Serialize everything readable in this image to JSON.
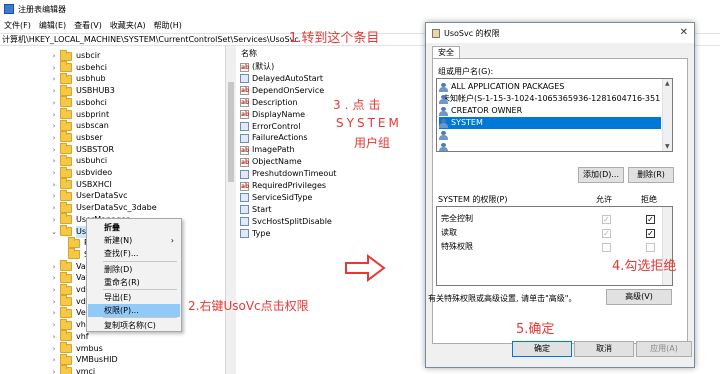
{
  "window": {
    "title": "注册表编辑器",
    "menu": [
      "文件(F)",
      "编辑(E)",
      "查看(V)",
      "收藏夹(A)",
      "帮助(H)"
    ],
    "address": "计算机\\HKEY_LOCAL_MACHINE\\SYSTEM\\CurrentControlSet\\Services\\UsoSvc"
  },
  "tree": {
    "items": [
      {
        "label": "usbcir",
        "chevron": "›"
      },
      {
        "label": "usbehci",
        "chevron": "›"
      },
      {
        "label": "usbhub",
        "chevron": "›"
      },
      {
        "label": "USBHUB3",
        "chevron": "›"
      },
      {
        "label": "usbohci",
        "chevron": "›"
      },
      {
        "label": "usbprint",
        "chevron": "›"
      },
      {
        "label": "usbscan",
        "chevron": "›"
      },
      {
        "label": "usbser",
        "chevron": "›"
      },
      {
        "label": "USBSTOR",
        "chevron": "›"
      },
      {
        "label": "usbuhci",
        "chevron": "›"
      },
      {
        "label": "usbvideo",
        "chevron": "›"
      },
      {
        "label": "USBXHCI",
        "chevron": "›"
      },
      {
        "label": "UserDataSvc",
        "chevron": "›"
      },
      {
        "label": "UserDataSvc_3dabe",
        "chevron": "›"
      },
      {
        "label": "UserManager",
        "chevron": "›"
      },
      {
        "label": "UsoSvc",
        "chevron": "⌄"
      },
      {
        "label": "P",
        "chevron": ""
      },
      {
        "label": "S",
        "chevron": ""
      },
      {
        "label": "Vac",
        "chevron": "›"
      },
      {
        "label": "Vau",
        "chevron": "›"
      },
      {
        "label": "vdrv",
        "chevron": "›"
      },
      {
        "label": "vds",
        "chevron": "›"
      },
      {
        "label": "Veri",
        "chevron": "›"
      },
      {
        "label": "vhd",
        "chevron": "›"
      },
      {
        "label": "vhf",
        "chevron": "›"
      },
      {
        "label": "vmbus",
        "chevron": "›"
      },
      {
        "label": "VMBusHID",
        "chevron": "›"
      },
      {
        "label": "vmci",
        "chevron": "›"
      }
    ]
  },
  "values": {
    "header": "名称",
    "items": [
      {
        "name": "(默认)",
        "type": "ab"
      },
      {
        "name": "DelayedAutoStart",
        "type": "bin"
      },
      {
        "name": "DependOnService",
        "type": "ab"
      },
      {
        "name": "Description",
        "type": "ab"
      },
      {
        "name": "DisplayName",
        "type": "ab"
      },
      {
        "name": "ErrorControl",
        "type": "bin"
      },
      {
        "name": "FailureActions",
        "type": "bin"
      },
      {
        "name": "ImagePath",
        "type": "ab"
      },
      {
        "name": "ObjectName",
        "type": "ab"
      },
      {
        "name": "PreshutdownTimeout",
        "type": "bin"
      },
      {
        "name": "RequiredPrivileges",
        "type": "ab"
      },
      {
        "name": "ServiceSidType",
        "type": "bin"
      },
      {
        "name": "Start",
        "type": "bin"
      },
      {
        "name": "SvcHostSplitDisable",
        "type": "bin"
      },
      {
        "name": "Type",
        "type": "bin"
      }
    ]
  },
  "context_menu": {
    "items": [
      "折叠",
      "新建(N)",
      "查找(F)...",
      "删除(D)",
      "重命名(R)",
      "导出(E)",
      "权限(P)...",
      "复制项名称(C)"
    ],
    "submenu_arrow": "›"
  },
  "dialog": {
    "title": "UsoSvc 的权限",
    "close": "✕",
    "tab": "安全",
    "groups_label": "组或用户名(G):",
    "users": [
      "ALL APPLICATION PACKAGES",
      "未知帐户(S-1-15-3-1024-1065365936-1281604716-3511738",
      "CREATOR OWNER",
      "SYSTEM",
      "",
      ""
    ],
    "add_button": "添加(D)...",
    "remove_button": "删除(R)",
    "perm_label": "SYSTEM 的权限(P)",
    "allow_header": "允许",
    "deny_header": "拒绝",
    "permissions": [
      {
        "name": "完全控制",
        "allow": "✓",
        "deny": "✓"
      },
      {
        "name": "读取",
        "allow": "✓",
        "deny": "✓"
      },
      {
        "name": "特殊权限",
        "allow": "",
        "deny": ""
      }
    ],
    "advanced_note": "有关特殊权限或高级设置, 请单击\"高级\"。",
    "advanced_button": "高级(V)",
    "ok_button": "确定",
    "cancel_button": "取消",
    "apply_button": "应用(A)"
  },
  "annotations": {
    "step1": "1.转到这个条目",
    "step2": "2.右键UsoVc点击权限",
    "step3a": "3.点击",
    "step3b": "SYSTEM",
    "step3c": "用户组",
    "step4": "4.勾选拒绝",
    "step5": "5.确定",
    "color": "#e53935"
  }
}
